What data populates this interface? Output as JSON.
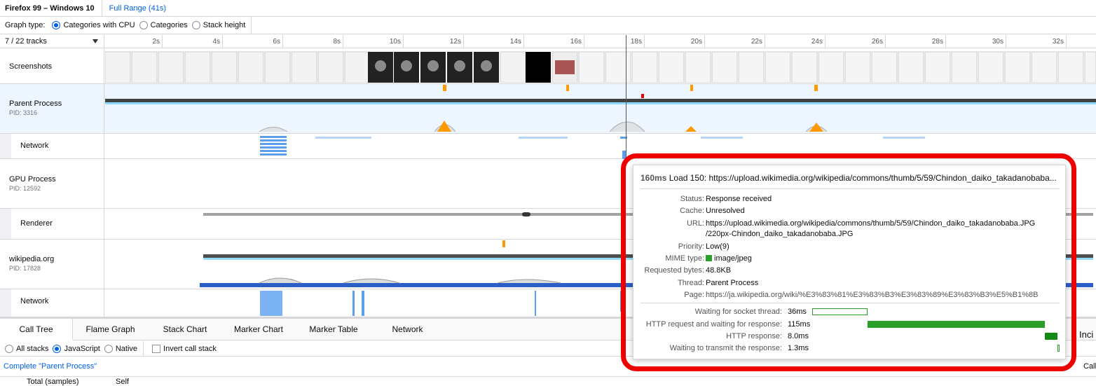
{
  "topbar": {
    "env": "Firefox 99 – Windows 10",
    "range": "Full Range (41s)"
  },
  "graphtype": {
    "label": "Graph type:",
    "options": [
      "Categories with CPU",
      "Categories",
      "Stack height"
    ],
    "selected": 0
  },
  "tracks": {
    "count": "7 / 22 tracks",
    "ticks": [
      "2s",
      "4s",
      "6s",
      "8s",
      "10s",
      "12s",
      "14s",
      "16s",
      "18s",
      "20s",
      "22s",
      "24s",
      "26s",
      "28s",
      "30s",
      "32s"
    ]
  },
  "track_names": {
    "screenshots": "Screenshots",
    "parent": "Parent Process",
    "parent_pid": "PID: 3316",
    "network1": "Network",
    "gpu": "GPU Process",
    "gpu_pid": "PID: 12592",
    "renderer": "Renderer",
    "wiki": "wikipedia.org",
    "wiki_pid": "PID: 17828",
    "network2": "Network"
  },
  "tooltip": {
    "duration": "160ms",
    "title": "Load 150: https://upload.wikimedia.org/wikipedia/commons/thumb/5/59/Chindon_daiko_takadanobaba...",
    "rows": [
      {
        "k": "Status:",
        "v": "Response received"
      },
      {
        "k": "Cache:",
        "v": "Unresolved"
      },
      {
        "k": "URL:",
        "v": "https://upload.wikimedia.org/wikipedia/commons/thumb/5/59/Chindon_daiko_takadanobaba.JPG",
        "v2": "/220px-Chindon_daiko_takadanobaba.JPG"
      },
      {
        "k": "Priority:",
        "v": "Low(9)"
      },
      {
        "k": "MIME type:",
        "v": "image/jpeg"
      },
      {
        "k": "Requested bytes:",
        "v": "48.8KB"
      },
      {
        "k": "Thread:",
        "v": "Parent Process"
      },
      {
        "k": "Page:",
        "v": "https://ja.wikipedia.org/wiki/%E3%83%81%E3%83%B3%E3%83%89%E3%83%B3%E5%B1%8B"
      }
    ],
    "phases": [
      {
        "k": "Waiting for socket thread:",
        "v": "36ms"
      },
      {
        "k": "HTTP request and waiting for response:",
        "v": "115ms"
      },
      {
        "k": "HTTP response:",
        "v": "8.0ms"
      },
      {
        "k": "Waiting to transmit the response:",
        "v": "1.3ms"
      }
    ],
    "phase_fraction": [
      0.225,
      0.719,
      0.05,
      0.008
    ],
    "mime_color": "#2a9f2a"
  },
  "bottom": {
    "tabs": [
      "Call Tree",
      "Flame Graph",
      "Stack Chart",
      "Marker Chart",
      "Marker Table",
      "Network"
    ],
    "stack_opts": [
      "All stacks",
      "JavaScript",
      "Native"
    ],
    "invert": "Invert call stack",
    "complete": "Complete \"Parent Process\"",
    "col_total": "Total (samples)",
    "col_self": "Self",
    "cut1": "Inci",
    "cut2": "Call"
  }
}
